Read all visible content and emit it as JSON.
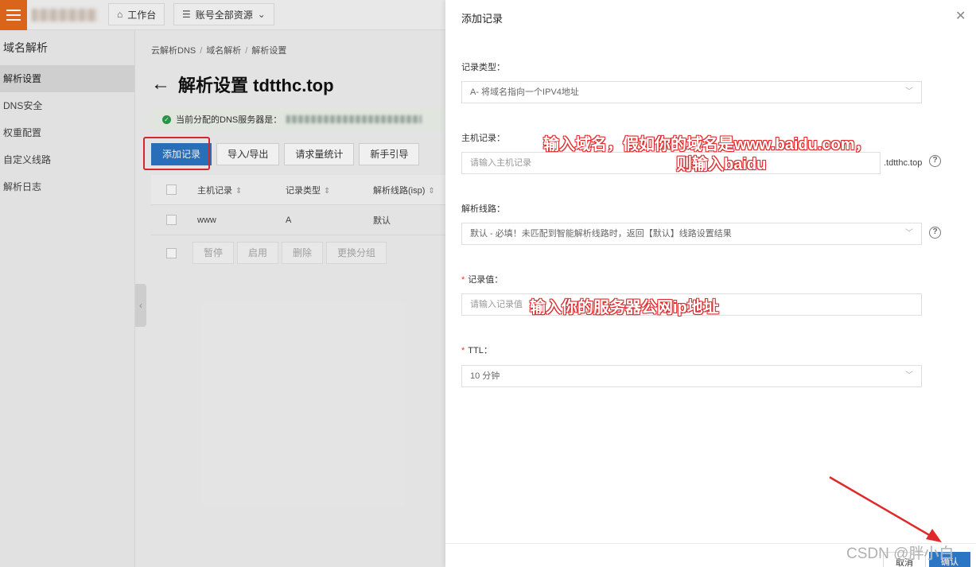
{
  "topbar": {
    "workbench": "工作台",
    "resources": "账号全部资源"
  },
  "sidebar": {
    "title": "域名解析",
    "items": [
      {
        "label": "解析设置",
        "active": true
      },
      {
        "label": "DNS安全"
      },
      {
        "label": "权重配置"
      },
      {
        "label": "自定义线路"
      },
      {
        "label": "解析日志"
      }
    ]
  },
  "main": {
    "breadcrumb": [
      "云解析DNS",
      "域名解析",
      "解析设置"
    ],
    "title": "解析设置 tdtthc.top",
    "notice": "当前分配的DNS服务器是：",
    "toolbar": {
      "add_record": "添加记录",
      "import_export": "导入/导出",
      "request_stats": "请求量统计",
      "guide": "新手引导"
    },
    "table": {
      "columns": [
        "主机记录",
        "记录类型",
        "解析线路(isp)"
      ],
      "rows": [
        {
          "host": "www",
          "type": "A",
          "line": "默认"
        }
      ]
    },
    "batch": [
      "暂停",
      "启用",
      "删除",
      "更换分组"
    ]
  },
  "drawer": {
    "title": "添加记录",
    "record_type": {
      "label": "记录类型：",
      "value": "A- 将域名指向一个IPV4地址"
    },
    "host": {
      "label": "主机记录：",
      "placeholder": "请输入主机记录",
      "suffix": ".tdtthc.top"
    },
    "line": {
      "label": "解析线路：",
      "value": "默认 - 必填！未匹配到智能解析线路时，返回【默认】线路设置结果"
    },
    "record_value": {
      "label": "记录值：",
      "placeholder": "请输入记录值"
    },
    "ttl": {
      "label": "TTL：",
      "value": "10 分钟"
    },
    "cancel": "取消",
    "confirm": "确认"
  },
  "annotations": {
    "host_line1": "输入域名，假如你的域名是www.baidu.com，",
    "host_line2": "则输入baidu",
    "value_note": "输入你的服务器公网ip地址"
  },
  "watermark": "CSDN @胖小白",
  "colors": {
    "accent": "#2b75c5",
    "brand_orange": "#e86b1c",
    "annotation_red": "#e0292b"
  }
}
